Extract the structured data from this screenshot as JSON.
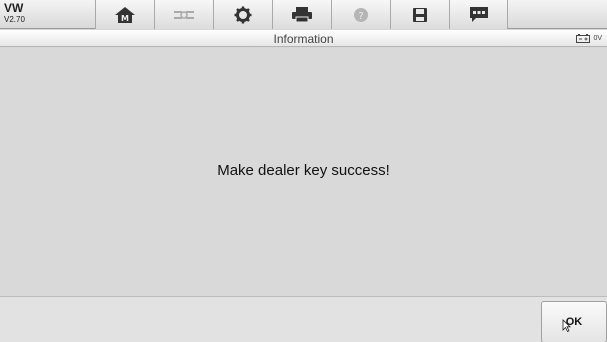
{
  "vehicle": {
    "make": "VW",
    "version": "V2.70"
  },
  "toolbar": {
    "buttons": [
      {
        "icon": "home-icon"
      },
      {
        "icon": "vehicle-swap-icon"
      },
      {
        "icon": "gear-icon"
      },
      {
        "icon": "printer-icon"
      },
      {
        "icon": "help-icon"
      },
      {
        "icon": "save-icon"
      },
      {
        "icon": "message-icon"
      }
    ]
  },
  "titlebar": {
    "title": "Information",
    "battery_voltage": "0V"
  },
  "content": {
    "message": "Make dealer key success!"
  },
  "footer": {
    "ok_label": "OK"
  },
  "colors": {
    "background": "#d9d9d9",
    "toolbar": "#e6e6e6"
  }
}
